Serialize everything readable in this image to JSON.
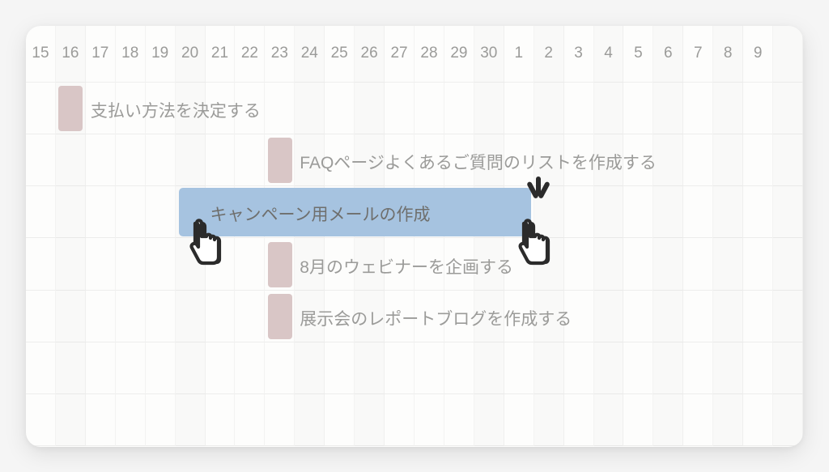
{
  "timeline": {
    "days": [
      15,
      16,
      17,
      18,
      19,
      20,
      21,
      22,
      23,
      24,
      25,
      26,
      27,
      28,
      29,
      30,
      1,
      2,
      3,
      4,
      5,
      6,
      7,
      8,
      9
    ],
    "alt_columns": [
      1,
      5,
      9,
      11,
      15,
      17,
      19,
      21,
      23,
      25
    ]
  },
  "tasks": [
    {
      "id": "task-payment",
      "label": "支払い方法を決定する",
      "row": 1,
      "label_col": 2,
      "marker_col": 1,
      "active": false
    },
    {
      "id": "task-faq",
      "label": "FAQページよくあるご質問のリストを作成する",
      "row": 2,
      "label_col": 9,
      "marker_col": 8,
      "active": false
    },
    {
      "id": "task-campaign",
      "label": "キャンペーン用メールの作成",
      "row": 3,
      "label_col": 6,
      "bar_start": 5,
      "bar_end": 16,
      "active": true
    },
    {
      "id": "task-webinar",
      "label": "8月のウェビナーを企画する",
      "row": 4,
      "label_col": 9,
      "marker_col": 8,
      "active": false
    },
    {
      "id": "task-report",
      "label": "展示会のレポートブログを作成する",
      "row": 5,
      "label_col": 9,
      "marker_col": 8,
      "active": false
    }
  ],
  "cursors": {
    "start": {
      "row": 3,
      "col": 5
    },
    "end": {
      "row": 3,
      "col": 16
    }
  }
}
